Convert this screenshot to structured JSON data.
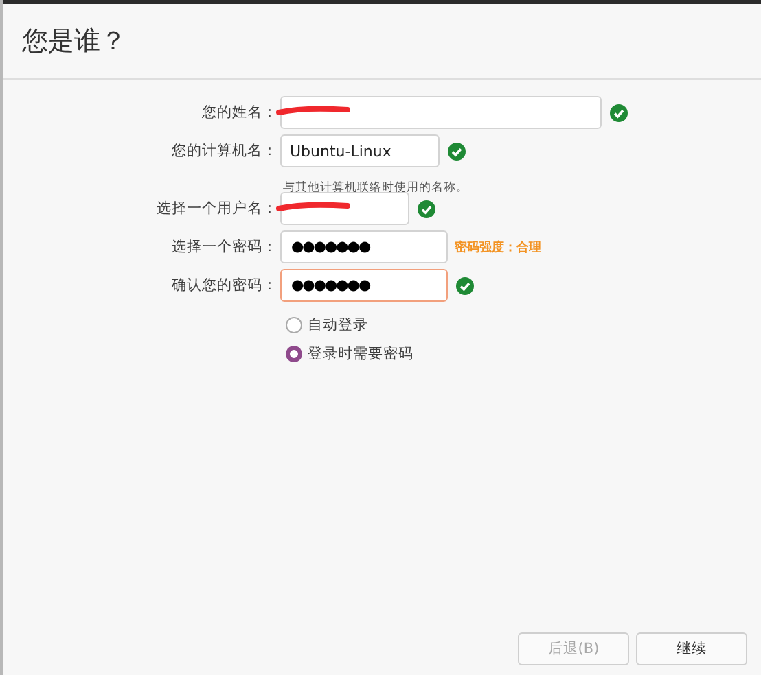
{
  "title": "您是谁？",
  "fields": [
    {
      "label": "您的姓名：",
      "redacted": true,
      "valid": true,
      "error": false,
      "kind": "text"
    },
    {
      "label": "您的计算机名：",
      "value": "Ubuntu-Linux",
      "redacted": false,
      "valid": true,
      "error": false,
      "kind": "text",
      "hint": "与其他计算机联络时使用的名称。"
    },
    {
      "label": "选择一个用户名：",
      "redacted": true,
      "valid": true,
      "error": false,
      "kind": "text"
    },
    {
      "label": "选择一个密码：",
      "value": "●●●●●●●",
      "redacted": false,
      "valid": false,
      "error": false,
      "kind": "password",
      "strength": "密码强度：合理"
    },
    {
      "label": "确认您的密码：",
      "value": "●●●●●●●",
      "redacted": false,
      "valid": true,
      "error": true,
      "kind": "password"
    }
  ],
  "login_options": [
    {
      "label": "自动登录",
      "selected": false
    },
    {
      "label": "登录时需要密码",
      "selected": true
    }
  ],
  "buttons": [
    {
      "label": "后退(B)",
      "disabled": true
    },
    {
      "label": "继续",
      "disabled": false
    }
  ]
}
